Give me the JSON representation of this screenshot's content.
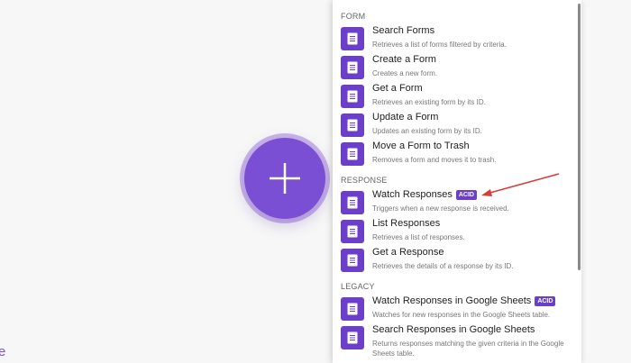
{
  "canvas": {
    "edge_text": "e"
  },
  "colors": {
    "accent": "#6c3fc9",
    "add_button": "#7a4fd3",
    "arrow": "#d93a3a"
  },
  "sections": [
    {
      "header": "FORM",
      "items": [
        {
          "title": "Search Forms",
          "desc": "Retrieves a list of forms filtered by criteria.",
          "icon": "document-icon"
        },
        {
          "title": "Create a Form",
          "desc": "Creates a new form.",
          "icon": "document-icon"
        },
        {
          "title": "Get a Form",
          "desc": "Retrieves an existing form by its ID.",
          "icon": "document-icon"
        },
        {
          "title": "Update a Form",
          "desc": "Updates an existing form by its ID.",
          "icon": "document-icon"
        },
        {
          "title": "Move a Form to Trash",
          "desc": "Removes a form and moves it to trash.",
          "icon": "document-icon"
        }
      ]
    },
    {
      "header": "RESPONSE",
      "items": [
        {
          "title": "Watch Responses",
          "badge": "ACID",
          "desc": "Triggers when a new response is received.",
          "icon": "document-icon"
        },
        {
          "title": "List Responses",
          "desc": "Retrieves a list of responses.",
          "icon": "document-icon"
        },
        {
          "title": "Get a Response",
          "desc": "Retrieves the details of a response by its ID.",
          "icon": "document-icon"
        }
      ]
    },
    {
      "header": "LEGACY",
      "items": [
        {
          "title": "Watch Responses in Google Sheets",
          "badge": "ACID",
          "desc": "Watches for new responses in the Google Sheets table.",
          "icon": "document-icon"
        },
        {
          "title": "Search Responses in Google Sheets",
          "desc": "Returns responses matching the given criteria in the Google Sheets table.",
          "icon": "document-icon"
        }
      ]
    }
  ]
}
